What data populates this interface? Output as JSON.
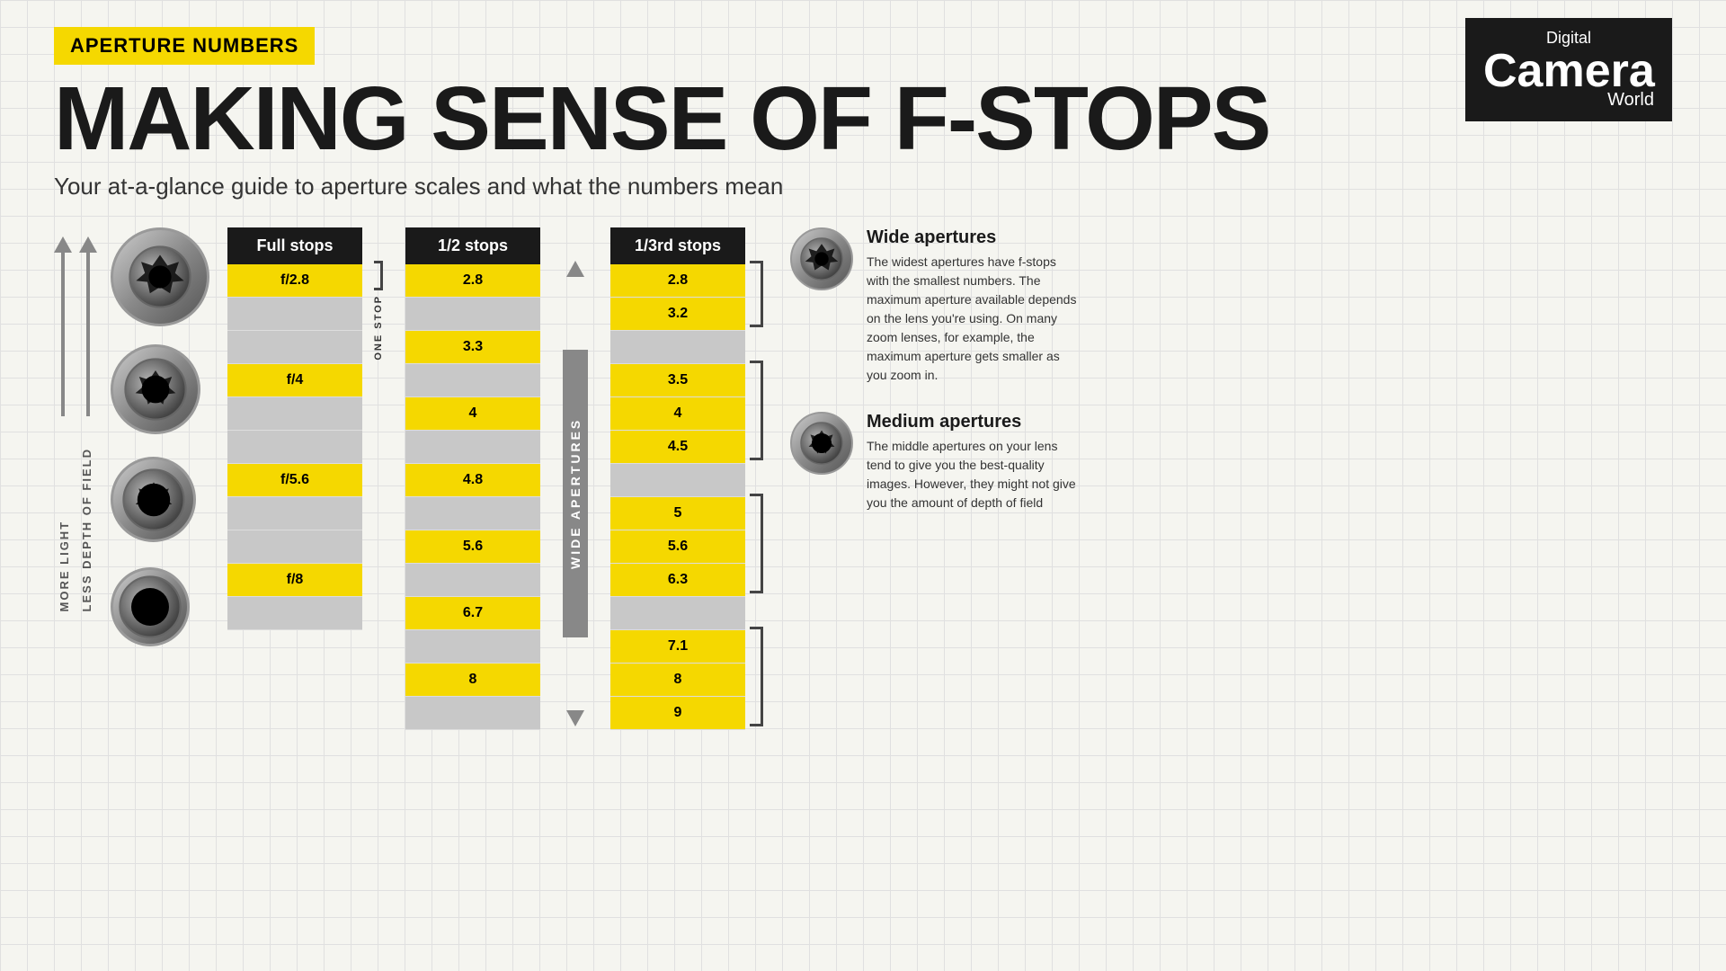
{
  "badge": {
    "label": "APERTURE NUMBERS"
  },
  "title": "MAKING SENSE OF F-STOPS",
  "subtitle": "Your at-a-glance guide to aperture scales and what the numbers mean",
  "logo": {
    "digital": "Digital",
    "camera": "Camera",
    "world": "World"
  },
  "tables": {
    "full_stops": {
      "header": "Full stops",
      "rows": [
        "f/2.8",
        "",
        "f/4",
        "",
        "f/5.6",
        "",
        "f/8",
        ""
      ]
    },
    "half_stops": {
      "header": "1/2 stops",
      "rows": [
        "2.8",
        "",
        "3.3",
        "",
        "4",
        "",
        "4.8",
        "",
        "5.6",
        "",
        "6.7",
        "",
        "8",
        ""
      ]
    },
    "third_stops": {
      "header": "1/3rd stops",
      "rows": [
        "2.8",
        "3.2",
        "",
        "3.5",
        "4",
        "4.5",
        "",
        "5",
        "5.6",
        "6.3",
        "",
        "7.1",
        "8",
        "9"
      ]
    }
  },
  "labels": {
    "more_light": "MORE LIGHT",
    "less_depth": "LESS DEPTH OF FIELD",
    "one_stop": "ONE STOP",
    "wide_apertures": "WIDE APERTURES"
  },
  "descriptions": {
    "wide": {
      "title": "Wide apertures",
      "text": "The widest apertures have f-stops with the smallest numbers. The maximum aperture available depends on the lens you're using. On many zoom lenses, for example, the maximum aperture gets smaller as you zoom in."
    },
    "medium": {
      "title": "Medium apertures",
      "text": "The middle apertures on your lens tend to give you the best-quality images. However, they might not give you the amount of depth of field"
    }
  }
}
